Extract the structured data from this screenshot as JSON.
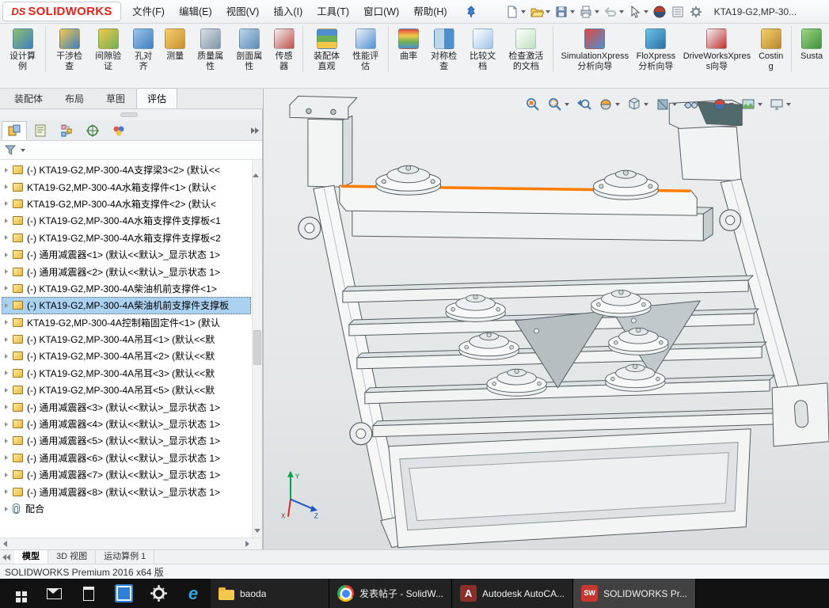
{
  "window": {
    "logo_mark": "DS",
    "logo_text": "SOLIDWORKS",
    "title": "KTA19-G2,MP-30..."
  },
  "menubar": {
    "items": [
      {
        "label": "文件(F)"
      },
      {
        "label": "编辑(E)"
      },
      {
        "label": "视图(V)"
      },
      {
        "label": "插入(I)"
      },
      {
        "label": "工具(T)"
      },
      {
        "label": "窗口(W)"
      },
      {
        "label": "帮助(H)"
      }
    ],
    "quick_tools": [
      "new-document",
      "open-document",
      "save-document",
      "print-document",
      "undo",
      "select",
      "solidworks-resources",
      "task-pane",
      "options-gear"
    ],
    "pin_icon": "pin-icon"
  },
  "ribbon": {
    "tabs": [
      {
        "label": "装配体",
        "active": false
      },
      {
        "label": "布局",
        "active": false
      },
      {
        "label": "草图",
        "active": false
      },
      {
        "label": "评估",
        "active": true
      }
    ],
    "buttons": [
      {
        "label": "设计算例",
        "icon": "design-study",
        "sep_after": true
      },
      {
        "label": "干涉检查",
        "icon": "interference-check"
      },
      {
        "label": "间隙验证",
        "icon": "clearance-verify"
      },
      {
        "label": "孔对齐",
        "icon": "hole-alignment"
      },
      {
        "label": "测量",
        "icon": "measure"
      },
      {
        "label": "质量属性",
        "icon": "mass-properties"
      },
      {
        "label": "剖面属性",
        "icon": "section-properties"
      },
      {
        "label": "传感器",
        "icon": "sensor",
        "sep_after": true
      },
      {
        "label": "装配体直观",
        "icon": "assembly-visualization"
      },
      {
        "label": "性能评估",
        "icon": "performance-evaluation",
        "sep_after": true
      },
      {
        "label": "曲率",
        "icon": "curvature"
      },
      {
        "label": "对称检查",
        "icon": "symmetry-check"
      },
      {
        "label": "比较文档",
        "icon": "compare-documents"
      },
      {
        "label": "检查激活的文档",
        "icon": "check-active-document",
        "size": "m",
        "sep_after": true
      },
      {
        "label": "SimulationXpress分析向导",
        "icon": "simulationxpress",
        "size": "l"
      },
      {
        "label": "FloXpress分析向导",
        "icon": "floxpress",
        "size": "m"
      },
      {
        "label": "DriveWorksXpress向导",
        "icon": "driveworksxpress",
        "size": "l"
      },
      {
        "label": "Costing",
        "icon": "costing",
        "sep_after": true
      },
      {
        "label": "Susta",
        "icon": "sustainability"
      }
    ]
  },
  "panel": {
    "tabs": [
      {
        "name": "feature-manager",
        "active": true
      },
      {
        "name": "property-manager",
        "active": false
      },
      {
        "name": "configuration-manager",
        "active": false
      },
      {
        "name": "dimxpert-manager",
        "active": false
      },
      {
        "name": "display-manager",
        "active": false
      }
    ],
    "filter_icon": "filter-funnel-icon"
  },
  "feature_tree": {
    "items": [
      {
        "label": "(-) KTA19-G2,MP-300-4A支撑梁3<2> (默认<<",
        "icon": "component",
        "selected": false
      },
      {
        "label": "KTA19-G2,MP-300-4A水箱支撑件<1> (默认<",
        "icon": "component",
        "selected": false
      },
      {
        "label": "KTA19-G2,MP-300-4A水箱支撑件<2> (默认<",
        "icon": "component",
        "selected": false
      },
      {
        "label": "(-) KTA19-G2,MP-300-4A水箱支撑件支撑板<1",
        "icon": "component",
        "selected": false
      },
      {
        "label": "(-) KTA19-G2,MP-300-4A水箱支撑件支撑板<2",
        "icon": "component",
        "selected": false
      },
      {
        "label": "(-) 通用减震器<1> (默认<<默认>_显示状态 1>",
        "icon": "component",
        "selected": false
      },
      {
        "label": "(-) 通用减震器<2> (默认<<默认>_显示状态 1>",
        "icon": "component",
        "selected": false
      },
      {
        "label": "(-) KTA19-G2,MP-300-4A柴油机前支撑件<1>",
        "icon": "component",
        "selected": false
      },
      {
        "label": "(-) KTA19-G2,MP-300-4A柴油机前支撑件支撑板",
        "icon": "component",
        "selected": true
      },
      {
        "label": "KTA19-G2,MP-300-4A控制箱固定件<1> (默认",
        "icon": "component",
        "selected": false
      },
      {
        "label": "(-) KTA19-G2,MP-300-4A吊耳<1> (默认<<默",
        "icon": "component",
        "selected": false
      },
      {
        "label": "(-) KTA19-G2,MP-300-4A吊耳<2> (默认<<默",
        "icon": "component",
        "selected": false
      },
      {
        "label": "(-) KTA19-G2,MP-300-4A吊耳<3> (默认<<默",
        "icon": "component",
        "selected": false
      },
      {
        "label": "(-) KTA19-G2,MP-300-4A吊耳<5> (默认<<默",
        "icon": "component",
        "selected": false
      },
      {
        "label": "(-) 通用减震器<3> (默认<<默认>_显示状态 1>",
        "icon": "component",
        "selected": false
      },
      {
        "label": "(-) 通用减震器<4> (默认<<默认>_显示状态 1>",
        "icon": "component",
        "selected": false
      },
      {
        "label": "(-) 通用减震器<5> (默认<<默认>_显示状态 1>",
        "icon": "component",
        "selected": false
      },
      {
        "label": "(-) 通用减震器<6> (默认<<默认>_显示状态 1>",
        "icon": "component",
        "selected": false
      },
      {
        "label": "(-) 通用减震器<7> (默认<<默认>_显示状态 1>",
        "icon": "component",
        "selected": false
      },
      {
        "label": "(-) 通用减震器<8> (默认<<默认>_显示状态 1>",
        "icon": "component",
        "selected": false
      },
      {
        "label": "配合",
        "icon": "mates",
        "selected": false
      }
    ]
  },
  "viewport": {
    "headsup_icons": [
      "zoom-to-fit",
      "zoom-to-area",
      "previous-view",
      "section-view",
      "view-orientation",
      "display-style",
      "hide-show-items",
      "edit-appearance",
      "apply-scene",
      "view-settings"
    ],
    "selection_color": "#ff7d00",
    "triad": {
      "x": "X",
      "y": "Y",
      "z": "Z"
    }
  },
  "doc_bar": {
    "tabs": [
      {
        "label": "模型",
        "active": true
      },
      {
        "label": "3D 视图",
        "active": false
      },
      {
        "label": "运动算例 1",
        "active": false
      }
    ]
  },
  "statusbar": {
    "text": "SOLIDWORKS Premium 2016 x64 版"
  },
  "taskbar": {
    "pinned": [
      {
        "name": "mail",
        "glyph": ""
      },
      {
        "name": "calculator",
        "glyph": ""
      },
      {
        "name": "blue-app",
        "glyph": ""
      },
      {
        "name": "settings",
        "glyph": ""
      },
      {
        "name": "edge",
        "glyph": "e"
      }
    ],
    "apps": [
      {
        "label": "baoda",
        "icon": "folder",
        "glyph": "",
        "active": false
      },
      {
        "label": "发表帖子 - SolidW...",
        "icon": "chrome",
        "glyph": "",
        "active": false
      },
      {
        "label": "Autodesk AutoCA...",
        "icon": "autocad",
        "glyph": "A",
        "active": false
      },
      {
        "label": "SOLIDWORKS Pr...",
        "icon": "solidworks",
        "glyph": "SW",
        "active": true
      }
    ]
  }
}
